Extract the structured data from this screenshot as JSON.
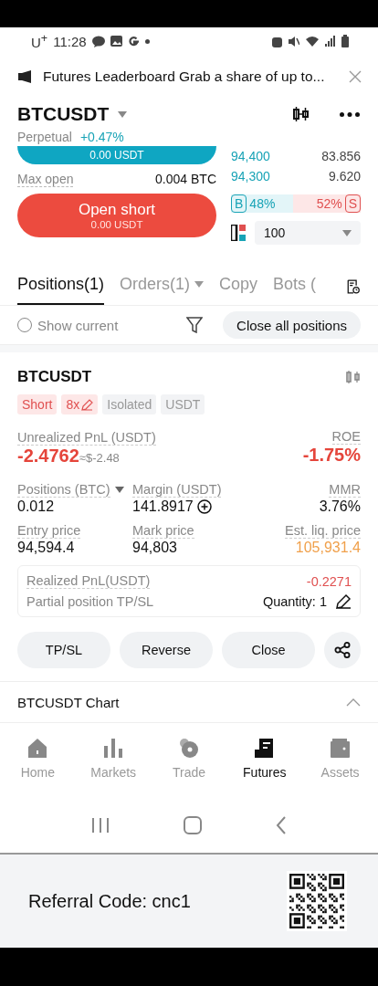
{
  "status_bar": {
    "carrier": "U$^{+}$",
    "time": "11:28"
  },
  "banner": {
    "text": "Futures Leaderboard Grab a share of up to..."
  },
  "header": {
    "symbol": "BTCUSDT",
    "contract": "Perpetual",
    "change": "+0.47%"
  },
  "order_form": {
    "long_button_value": "0.00 USDT",
    "max_open_label": "Max open",
    "max_open_value": "0.004 BTC",
    "short_button_label": "Open short",
    "short_button_value": "0.00 USDT"
  },
  "order_book": {
    "rows": [
      {
        "price": "94,400",
        "amount": "83.856"
      },
      {
        "price": "94,300",
        "amount": "9.620"
      }
    ],
    "buy_badge": "B",
    "buy_ratio": "48%",
    "sell_ratio": "52%",
    "sell_badge": "S",
    "depth_value": "100"
  },
  "tabs": [
    {
      "label": "Positions(1)",
      "selected": true,
      "dropdown": false
    },
    {
      "label": "Orders(1)",
      "selected": false,
      "dropdown": true
    },
    {
      "label": "Copy",
      "selected": false,
      "dropdown": false
    },
    {
      "label": "Bots (",
      "selected": false,
      "dropdown": false
    }
  ],
  "filter": {
    "show_current_label": "Show current",
    "show_current_checked": false,
    "close_all": "Close all positions"
  },
  "position": {
    "symbol": "BTCUSDT",
    "tags": [
      {
        "label": "Short",
        "kind": "side"
      },
      {
        "label": "8x",
        "kind": "leverage"
      },
      {
        "label": "Isolated",
        "kind": "plain"
      },
      {
        "label": "USDT",
        "kind": "plain"
      }
    ],
    "unrealized_label": "Unrealized PnL (USDT)",
    "unrealized_value": "-2.4762",
    "unrealized_usd": "≈$-2.48",
    "roe_label": "ROE",
    "roe_value": "-1.75%",
    "stats": [
      {
        "label": "Positions (BTC)",
        "value": "0.012",
        "kind": "dropdown"
      },
      {
        "label": "Margin (USDT)",
        "value": "141.8917",
        "kind": "add"
      },
      {
        "label": "MMR",
        "value": "3.76%",
        "kind": "plain"
      },
      {
        "label": "Entry price",
        "value": "94,594.4",
        "kind": "plain"
      },
      {
        "label": "Mark price",
        "value": "94,803",
        "kind": "plain"
      },
      {
        "label": "Est. liq. price",
        "value": "105,931.4",
        "kind": "warning"
      }
    ],
    "realized_label": "Realized PnL(USDT)",
    "realized_value": "-0.2271",
    "tpsl_label": "Partial position TP/SL",
    "tpsl_quantity": "Quantity: 1",
    "actions": [
      "TP/SL",
      "Reverse",
      "Close"
    ]
  },
  "chart_section": {
    "title": "BTCUSDT Chart",
    "expanded": true
  },
  "bottom_nav": [
    {
      "label": "Home",
      "kind": "home",
      "selected": false
    },
    {
      "label": "Markets",
      "kind": "markets",
      "selected": false
    },
    {
      "label": "Trade",
      "kind": "trade",
      "selected": false
    },
    {
      "label": "Futures",
      "kind": "futures",
      "selected": true
    },
    {
      "label": "Assets",
      "kind": "assets",
      "selected": false
    }
  ],
  "referral": {
    "text": "Referral Code: cnc1"
  }
}
